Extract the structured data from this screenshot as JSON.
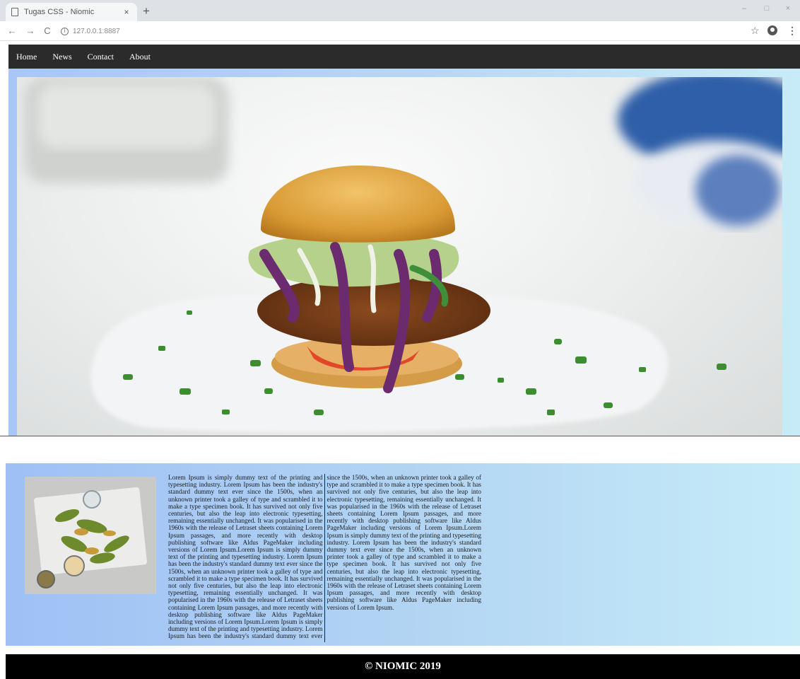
{
  "browser": {
    "tab_title": "Tugas CSS - Niomic",
    "tab_close": "×",
    "new_tab": "+",
    "url": "127.0.0.1:8887",
    "win_minimize": "–",
    "win_maximize": "□",
    "win_close": "×",
    "back": "←",
    "forward": "→",
    "reload": "C",
    "star": "☆",
    "menu": "⋮"
  },
  "nav": {
    "items": [
      "Home",
      "News",
      "Contact",
      "About"
    ]
  },
  "hero": {
    "image": "burger-photo"
  },
  "article": {
    "image": "fried-vegetables-photo",
    "text": "Lorem Ipsum is simply dummy text of the printing and typesetting industry. Lorem Ipsum has been the industry's standard dummy text ever since the 1500s, when an unknown printer took a galley of type and scrambled it to make a type specimen book. It has survived not only five centuries, but also the leap into electronic typesetting, remaining essentially unchanged. It was popularised in the 1960s with the release of Letraset sheets containing Lorem Ipsum passages, and more recently with desktop publishing software like Aldus PageMaker including versions of Lorem Ipsum.Lorem Ipsum is simply dummy text of the printing and typesetting industry. Lorem Ipsum has been the industry's standard dummy text ever since the 1500s, when an unknown printer took a galley of type and scrambled it to make a type specimen book. It has survived not only five centuries, but also the leap into electronic typesetting, remaining essentially unchanged. It was popularised in the 1960s with the release of Letraset sheets containing Lorem Ipsum passages, and more recently with desktop publishing software like Aldus PageMaker including versions of Lorem Ipsum.Lorem Ipsum is simply dummy text of the printing and typesetting industry. Lorem Ipsum has been the industry's standard dummy text ever since the 1500s, when an unknown printer took a galley of type and scrambled it to make a type specimen book. It has survived not only five centuries, but also the leap into electronic typesetting, remaining essentially unchanged. It was popularised in the 1960s with the release of Letraset sheets containing Lorem Ipsum passages, and more recently with desktop publishing software like Aldus PageMaker including versions of Lorem Ipsum.Lorem Ipsum is simply dummy text of the printing and typesetting industry. Lorem Ipsum has been the industry's standard dummy text ever since the 1500s, when an unknown printer took a galley of type and scrambled it to make a type specimen book. It has survived not only five centuries, but also the leap into electronic typesetting, remaining essentially unchanged. It was popularised in the 1960s with the release of Letraset sheets containing Lorem Ipsum passages, and more recently with desktop publishing software like Aldus PageMaker including versions of Lorem Ipsum."
  },
  "footer": {
    "text": "© NIOMIC 2019"
  },
  "colors": {
    "nav_bg": "#2b2b2b",
    "frame_gradient_start": "#9ec0f5",
    "frame_gradient_end": "#c6ecf8",
    "footer_bg": "#000000"
  }
}
